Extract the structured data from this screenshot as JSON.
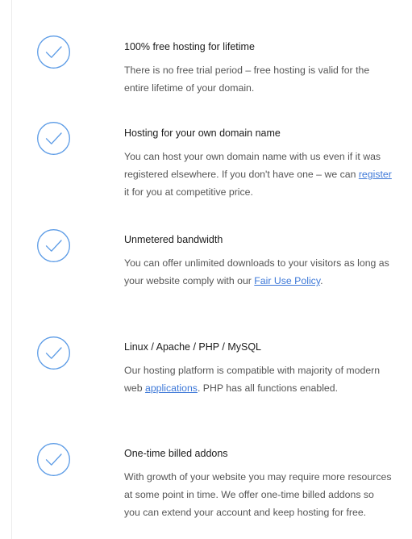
{
  "colors": {
    "accent": "#5b9be6",
    "link": "#3d78d8",
    "title": "#1b1b1b",
    "body": "#555555"
  },
  "features": [
    {
      "icon": "check-circle-icon",
      "title": "100% free hosting for lifetime",
      "desc_a": "There is no free trial period – free hosting is valid for the entire lifetime of your domain."
    },
    {
      "icon": "check-circle-icon",
      "title": "Hosting for your own domain name",
      "desc_a": "You can host your own domain name with us even if it was registered elsewhere. If you don't have one – we can ",
      "link": "register",
      "desc_b": " it for you at competitive price."
    },
    {
      "icon": "check-circle-icon",
      "title": "Unmetered bandwidth",
      "desc_a": "You can offer unlimited downloads to your visitors as long as your website comply with our ",
      "link": "Fair Use Policy",
      "desc_b": "."
    },
    {
      "icon": "check-circle-icon",
      "title": "Linux / Apache / PHP / MySQL",
      "desc_a": "Our hosting platform is compatible with majority of modern web ",
      "link": "applications",
      "desc_b": ". PHP has all functions enabled."
    },
    {
      "icon": "check-circle-icon",
      "title": "One-time billed addons",
      "desc_a": "With growth of your website you may require more resources at some point in time. We offer one-time billed addons so you can extend your account and keep hosting for free."
    }
  ]
}
